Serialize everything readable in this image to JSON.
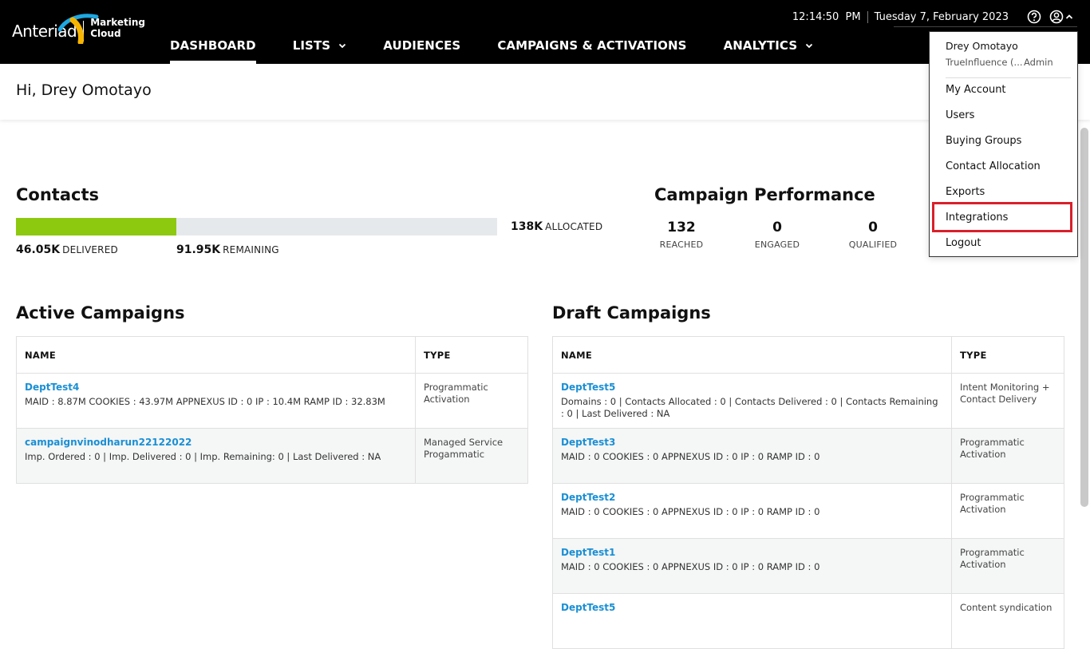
{
  "header": {
    "logo": {
      "brand": "Anteriad",
      "sub1": "Marketing",
      "sub2": "Cloud"
    },
    "time": "12:14:50  PM",
    "date": "Tuesday 7, February 2023",
    "nav": [
      {
        "label": "DASHBOARD",
        "active": true,
        "dropdown": false
      },
      {
        "label": "LISTS",
        "active": false,
        "dropdown": true
      },
      {
        "label": "AUDIENCES",
        "active": false,
        "dropdown": false
      },
      {
        "label": "CAMPAIGNS & ACTIVATIONS",
        "active": false,
        "dropdown": false
      },
      {
        "label": "ANALYTICS",
        "active": false,
        "dropdown": true
      }
    ],
    "icons": [
      "help-icon",
      "user-icon",
      "chevron-up-icon"
    ]
  },
  "greeting": "Hi, Drey Omotayo",
  "contacts": {
    "title": "Contacts",
    "delivered_value": "46.05K",
    "delivered_label": "DELIVERED",
    "remaining_value": "91.95K",
    "remaining_label": "REMAINING",
    "allocated_value": "138K",
    "allocated_label": "ALLOCATED",
    "delivered_fraction": 0.334,
    "colors": {
      "fill": "#8dc90f",
      "track": "#e6e9ec"
    }
  },
  "performance": {
    "title": "Campaign Performance",
    "stats": [
      {
        "value": "132",
        "label": "REACHED"
      },
      {
        "value": "0",
        "label": "ENGAGED"
      },
      {
        "value": "0",
        "label": "QUALIFIED"
      }
    ]
  },
  "active": {
    "title": "Active Campaigns",
    "col_name": "NAME",
    "col_type": "TYPE",
    "rows": [
      {
        "name": "DeptTest4",
        "detail": "MAID : 8.87M COOKIES : 43.97M APPNEXUS ID : 0 IP : 10.4M RAMP ID : 32.83M",
        "type": "Programmatic Activation"
      },
      {
        "name": "campaignvinodharun22122022",
        "detail": "Imp. Ordered : 0 | Imp. Delivered : 0 | Imp. Remaining: 0 | Last Delivered : NA",
        "type": "Managed Service Progammatic"
      }
    ]
  },
  "draft": {
    "title": "Draft Campaigns",
    "col_name": "NAME",
    "col_type": "TYPE",
    "rows": [
      {
        "name": "DeptTest5",
        "detail": "Domains : 0 | Contacts Allocated : 0 | Contacts Delivered : 0 | Contacts Remaining : 0 | Last Delivered : NA",
        "type": "Intent Monitoring + Contact Delivery"
      },
      {
        "name": "DeptTest3",
        "detail": "MAID : 0 COOKIES : 0 APPNEXUS ID : 0 IP : 0 RAMP ID : 0",
        "type": "Programmatic Activation"
      },
      {
        "name": "DeptTest2",
        "detail": "MAID : 0 COOKIES : 0 APPNEXUS ID : 0 IP : 0 RAMP ID : 0",
        "type": "Programmatic Activation"
      },
      {
        "name": "DeptTest1",
        "detail": "MAID : 0 COOKIES : 0 APPNEXUS ID : 0 IP : 0 RAMP ID : 0",
        "type": "Programmatic Activation"
      },
      {
        "name": "DeptTest5",
        "detail": "",
        "type": "Content syndication"
      }
    ]
  },
  "user_menu": {
    "user": "Drey Omotayo",
    "org": "TrueInfluence (...",
    "role": "Admin",
    "items": [
      "My Account",
      "Users",
      "Buying Groups",
      "Contact Allocation",
      "Exports",
      "Integrations",
      "Logout"
    ],
    "highlighted": "Integrations",
    "highlight_color": "#d9202a"
  }
}
